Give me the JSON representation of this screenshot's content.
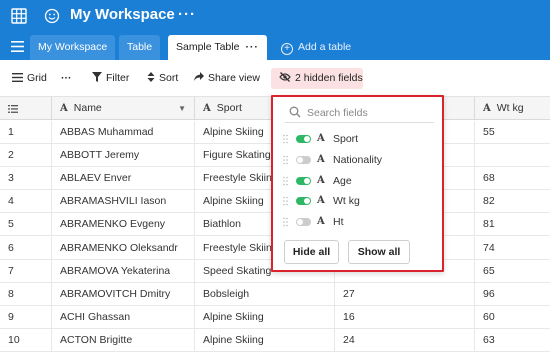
{
  "workspace": {
    "title": "My Workspace",
    "more": "···"
  },
  "tabs": {
    "workspace_label": "My Workspace",
    "table_label": "Table",
    "sample_label": "Sample Table",
    "sample_dots": "···",
    "add_table": "Add a table"
  },
  "toolbar": {
    "grid_label": "Grid",
    "more": "···",
    "filter_label": "Filter",
    "sort_label": "Sort",
    "share_label": "Share view",
    "hidden_label": "2 hidden fields"
  },
  "columns": {
    "name": "Name",
    "sport": "Sport",
    "wt": "Wt kg"
  },
  "rows": [
    {
      "num": "1",
      "name": "ABBAS Muhammad",
      "sport": "Alpine Skiing",
      "age": "",
      "wt": "55"
    },
    {
      "num": "2",
      "name": "ABBOTT Jeremy",
      "sport": "Figure Skating",
      "age": "",
      "wt": ""
    },
    {
      "num": "3",
      "name": "ABLAEV Enver",
      "sport": "Freestyle Skiing",
      "age": "",
      "wt": "68"
    },
    {
      "num": "4",
      "name": "ABRAMASHVILI Iason",
      "sport": "Alpine Skiing",
      "age": "",
      "wt": "82"
    },
    {
      "num": "5",
      "name": "ABRAMENKO Evgeny",
      "sport": "Biathlon",
      "age": "",
      "wt": "81"
    },
    {
      "num": "6",
      "name": "ABRAMENKO Oleksandr",
      "sport": "Freestyle Skiing",
      "age": "",
      "wt": "74"
    },
    {
      "num": "7",
      "name": "ABRAMOVA Yekaterina",
      "sport": "Speed Skating",
      "age": "",
      "wt": "65"
    },
    {
      "num": "8",
      "name": "ABRAMOVITCH Dmitry",
      "sport": "Bobsleigh",
      "age": "27",
      "wt": "96"
    },
    {
      "num": "9",
      "name": "ACHI Ghassan",
      "sport": "Alpine Skiing",
      "age": "16",
      "wt": "60"
    },
    {
      "num": "10",
      "name": "ACTON Brigitte",
      "sport": "Alpine Skiing",
      "age": "24",
      "wt": "63"
    }
  ],
  "hide_fields_popup": {
    "search_placeholder": "Search fields",
    "fields": [
      {
        "label": "Sport",
        "visible": true
      },
      {
        "label": "Nationality",
        "visible": false
      },
      {
        "label": "Age",
        "visible": true
      },
      {
        "label": "Wt kg",
        "visible": true
      },
      {
        "label": "Ht",
        "visible": false
      }
    ],
    "hide_all": "Hide all",
    "show_all": "Show all"
  },
  "colors": {
    "brand_blue": "#1c7fd6",
    "highlight_red": "#d9232d",
    "toggle_on": "#2eb865",
    "hidden_badge_bg": "#fbe1e1"
  }
}
